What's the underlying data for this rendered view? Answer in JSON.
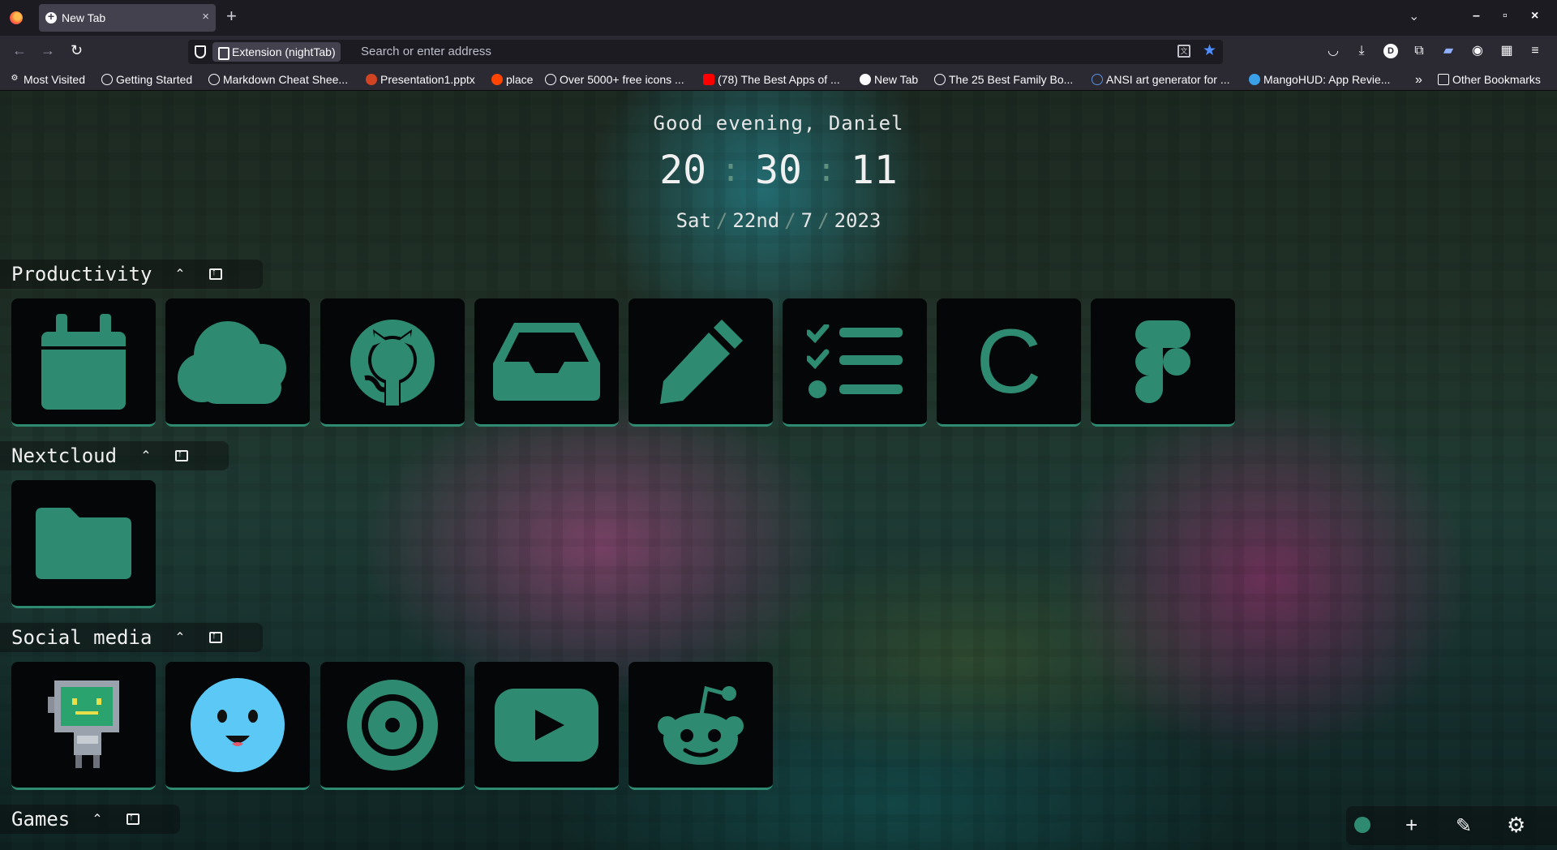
{
  "browser": {
    "tab_title": "New Tab",
    "tab_close": "×",
    "new_tab": "+",
    "url_chip": "Extension (nightTab)",
    "url_placeholder": "Search or enter address",
    "window": {
      "minimize": "–",
      "maximize": "▫",
      "close": "×"
    }
  },
  "bookmarks": [
    {
      "label": "Most Visited",
      "icon": "gear-icon"
    },
    {
      "label": "Getting Started",
      "icon": "globe-icon"
    },
    {
      "label": "Markdown Cheat Shee...",
      "icon": "globe-icon"
    },
    {
      "label": "Presentation1.pptx",
      "icon": "powerpoint-icon"
    },
    {
      "label": "place",
      "icon": "reddit-icon"
    },
    {
      "label": "Over 5000+ free icons ...",
      "icon": "globe-icon"
    },
    {
      "label": "(78) The Best Apps of ...",
      "icon": "youtube-icon"
    },
    {
      "label": "New Tab",
      "icon": "firefox-icon"
    },
    {
      "label": "The 25 Best Family Bo...",
      "icon": "globe-icon"
    },
    {
      "label": "ANSI art generator for ...",
      "icon": "link-icon"
    },
    {
      "label": "MangoHUD: App Revie...",
      "icon": "mango-icon"
    }
  ],
  "bookmarks_more": "»",
  "other_bookmarks": "Other Bookmarks",
  "greeting": "Good evening, Daniel",
  "clock": {
    "hours": "20",
    "minutes": "30",
    "seconds": "11",
    "separator": ":"
  },
  "date": {
    "day": "Sat",
    "date": "22nd",
    "month": "7",
    "year": "2023",
    "separator": "/"
  },
  "groups": [
    {
      "title": "Productivity",
      "collapse": "⌃",
      "bookmarks": [
        {
          "name": "calendar",
          "icon": "calendar-icon"
        },
        {
          "name": "cloud",
          "icon": "cloud-icon"
        },
        {
          "name": "github",
          "icon": "github-icon"
        },
        {
          "name": "inbox",
          "icon": "inbox-icon"
        },
        {
          "name": "notes",
          "icon": "pencil-icon"
        },
        {
          "name": "tasks",
          "icon": "checklist-icon"
        },
        {
          "name": "c-app",
          "letter": "C"
        },
        {
          "name": "figma",
          "icon": "figma-icon"
        }
      ]
    },
    {
      "title": "Nextcloud",
      "collapse": "⌃",
      "bookmarks": [
        {
          "name": "files",
          "icon": "folder-icon"
        }
      ]
    },
    {
      "title": "Social media",
      "collapse": "⌃",
      "bookmarks": [
        {
          "name": "robot",
          "icon": "robot-icon"
        },
        {
          "name": "smiley",
          "icon": "smiley-icon"
        },
        {
          "name": "target",
          "icon": "target-icon"
        },
        {
          "name": "youtube",
          "icon": "youtube-icon"
        },
        {
          "name": "reddit",
          "icon": "reddit-icon"
        }
      ]
    },
    {
      "title": "Games",
      "collapse": "⌃",
      "bookmarks": []
    }
  ],
  "controls": {
    "add": "+",
    "edit": "✎",
    "settings": "⚙"
  },
  "colors": {
    "accent": "#2e8b72",
    "tile_bg": "#050607",
    "chrome_bg": "#1c1b22",
    "toolbar_bg": "#2b2a33"
  }
}
